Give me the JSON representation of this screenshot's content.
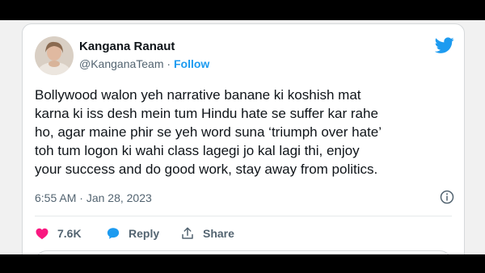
{
  "tweet": {
    "author_name": "Kangana Ranaut",
    "handle": "@KanganaTeam",
    "separator": "·",
    "follow_label": "Follow",
    "text_lines": [
      "Bollywood walon yeh narrative banane ki koshish mat",
      "karna ki iss desh mein tum Hindu hate se suffer kar rahe",
      "ho, agar maine phir se yeh word suna ‘triumph over hate’",
      "toh tum logon ki wahi class lagegi jo kal lagi thi, enjoy",
      "your success and do good work, stay away from politics."
    ],
    "time": "6:55 AM",
    "date": "Jan 28, 2023"
  },
  "actions": {
    "likes": "7.6K",
    "reply_label": "Reply",
    "share_label": "Share"
  },
  "colors": {
    "accent": "#1d9bf0",
    "like": "#f91880",
    "text": "#0f1419",
    "muted": "#536471"
  }
}
